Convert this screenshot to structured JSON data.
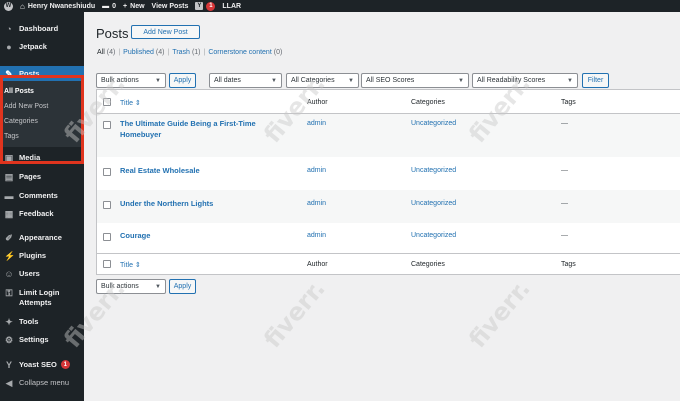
{
  "adminbar": {
    "site_name": "Henry Nwaneshiudu",
    "comments_count": "0",
    "new_label": "New",
    "view_posts_label": "View Posts",
    "yoast_count": "1",
    "llar_label": "LLAR"
  },
  "sidebar": {
    "items": [
      {
        "label": "Dashboard",
        "icon": "dashboard-icon"
      },
      {
        "label": "Jetpack",
        "icon": "jetpack-icon"
      },
      {
        "label": "Posts",
        "icon": "pin-icon"
      },
      {
        "label": "Media",
        "icon": "media-icon"
      },
      {
        "label": "Pages",
        "icon": "pages-icon"
      },
      {
        "label": "Comments",
        "icon": "comments-icon"
      },
      {
        "label": "Feedback",
        "icon": "feedback-icon"
      },
      {
        "label": "Appearance",
        "icon": "appearance-icon"
      },
      {
        "label": "Plugins",
        "icon": "plugins-icon"
      },
      {
        "label": "Users",
        "icon": "users-icon"
      },
      {
        "label": "Limit Login Attempts",
        "icon": "lock-icon"
      },
      {
        "label": "Tools",
        "icon": "tools-icon"
      },
      {
        "label": "Settings",
        "icon": "settings-icon"
      },
      {
        "label": "Yoast SEO",
        "icon": "yoast-icon",
        "badge": "1"
      },
      {
        "label": "Collapse menu",
        "icon": "collapse-icon"
      }
    ],
    "submenu": [
      "All Posts",
      "Add New Post",
      "Categories",
      "Tags"
    ]
  },
  "main": {
    "title": "Posts",
    "add_new": "Add New Post",
    "filters": {
      "all": "All",
      "all_count": "(4)",
      "published": "Published",
      "published_count": "(4)",
      "trash": "Trash",
      "trash_count": "(1)",
      "cornerstone": "Cornerstone content",
      "cornerstone_count": "(0)"
    },
    "toolbar": {
      "bulk_actions": "Bulk actions",
      "apply": "Apply",
      "dates": "All dates",
      "categories": "All Categories",
      "seo": "All SEO Scores",
      "readability": "All Readability Scores",
      "filter": "Filter"
    },
    "columns": {
      "title": "Title",
      "author": "Author",
      "categories": "Categories",
      "tags": "Tags"
    },
    "posts": [
      {
        "title": "The Ultimate Guide Being a First-Time Homebuyer",
        "author": "admin",
        "category": "Uncategorized",
        "tags": "—"
      },
      {
        "title": "Real Estate Wholesale",
        "author": "admin",
        "category": "Uncategorized",
        "tags": "—"
      },
      {
        "title": "Under the Northern Lights",
        "author": "admin",
        "category": "Uncategorized",
        "tags": "—"
      },
      {
        "title": "Courage",
        "author": "admin",
        "category": "Uncategorized",
        "tags": "—"
      }
    ],
    "bottom_toolbar": {
      "bulk_actions": "Bulk actions",
      "apply": "Apply"
    }
  },
  "watermark": "fiverr.",
  "colors": {
    "accent": "#2271b1",
    "sidebar_bg": "#1d2327",
    "highlight": "#e0341e",
    "badge": "#d63638"
  }
}
